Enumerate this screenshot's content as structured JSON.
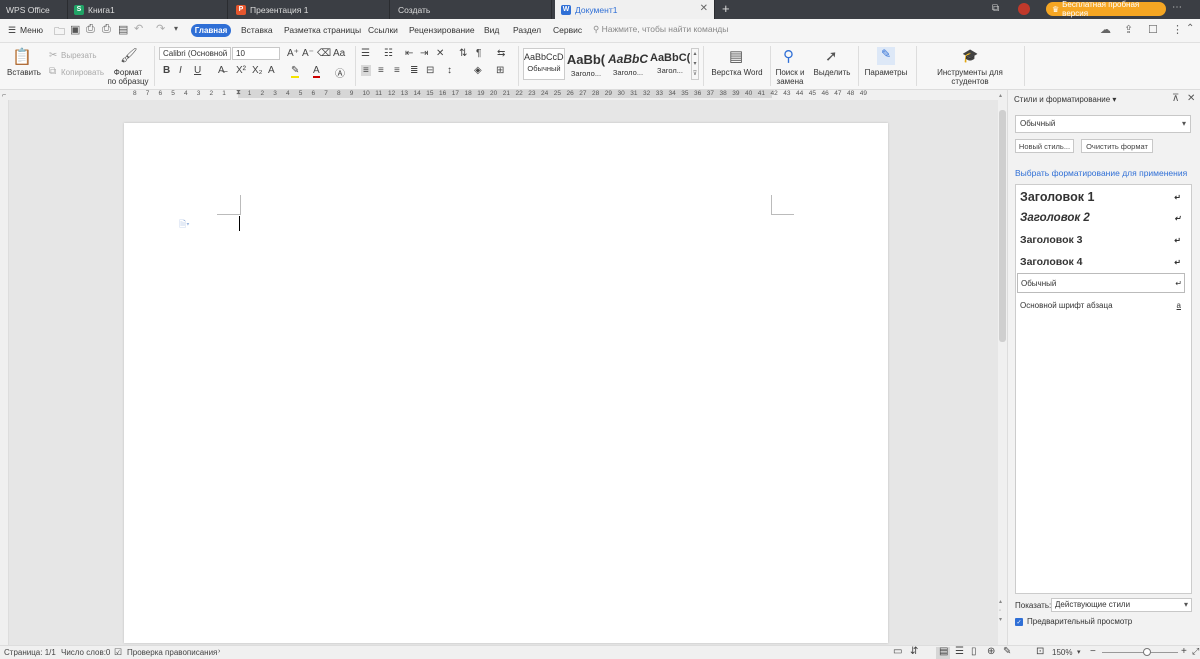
{
  "tabs": [
    {
      "label": "WPS Office",
      "icon": ""
    },
    {
      "label": "Книга1",
      "icon": "S"
    },
    {
      "label": "Презентация 1",
      "icon": "P"
    },
    {
      "label": "Создать",
      "icon": ""
    },
    {
      "label": "Документ1",
      "icon": "W"
    }
  ],
  "trial_label": "Бесплатная пробная версия",
  "menu": {
    "menu_label": "Меню",
    "items": [
      "Главная",
      "Вставка",
      "Разметка страницы",
      "Ссылки",
      "Рецензирование",
      "Вид",
      "Раздел",
      "Сервис"
    ],
    "search_placeholder": "Нажмите, чтобы найти команды"
  },
  "ribbon": {
    "paste": "Вставить",
    "cut": "Вырезать",
    "copy": "Копировать",
    "format_painter_1": "Формат",
    "format_painter_2": "по образцу",
    "font_name": "Calibri (Основной",
    "font_size": "10",
    "styles": [
      {
        "sample": "AaBbCcDd",
        "name": "Обычный"
      },
      {
        "sample": "AaBb(",
        "name": "Заголо..."
      },
      {
        "sample": "AaBbC",
        "name": "Заголо..."
      },
      {
        "sample": "AaBbC(",
        "name": "Загол..."
      }
    ],
    "word_layout": "Верстка Word",
    "find_1": "Поиск и",
    "find_2": "замена",
    "select": "Выделить",
    "params": "Параметры",
    "students": "Инструменты для студентов"
  },
  "ruler_numbers": [
    "8",
    "7",
    "6",
    "5",
    "4",
    "3",
    "2",
    "1",
    "",
    "1",
    "2",
    "3",
    "4",
    "5",
    "6",
    "7",
    "8",
    "9",
    "10",
    "11",
    "12",
    "13",
    "14",
    "15",
    "16",
    "17",
    "18",
    "19",
    "20",
    "21",
    "22",
    "23",
    "24",
    "25",
    "26",
    "27",
    "28",
    "29",
    "30",
    "31",
    "32",
    "33",
    "34",
    "35",
    "36",
    "37",
    "38",
    "39",
    "40",
    "41",
    "42",
    "43",
    "44",
    "45",
    "46",
    "47",
    "48",
    "49"
  ],
  "panel": {
    "title": "Стили и форматирование",
    "current_style": "Обычный",
    "new_style": "Новый стиль...",
    "clear_format": "Очистить формат",
    "choose_label": "Выбрать форматирование для применения",
    "styles": [
      {
        "label": "Заголовок 1",
        "mark": "↵"
      },
      {
        "label": "Заголовок 2",
        "mark": "↵"
      },
      {
        "label": "Заголовок 3",
        "mark": "↵"
      },
      {
        "label": "Заголовок 4",
        "mark": "↵"
      },
      {
        "label": "Обычный",
        "mark": "↵"
      },
      {
        "label": "Основной шрифт абзаца",
        "mark": "a"
      }
    ],
    "show_label": "Показать:",
    "show_value": "Действующие стили",
    "preview_label": "Предварительный просмотр"
  },
  "status": {
    "page": "Страница: 1/1",
    "words": "Число слов:0",
    "spell": "Проверка правописания",
    "zoom": "150%"
  },
  "colors": {
    "accent": "#2f6fd6",
    "tabbar": "#3b3e44",
    "trial": "#f5a623"
  }
}
